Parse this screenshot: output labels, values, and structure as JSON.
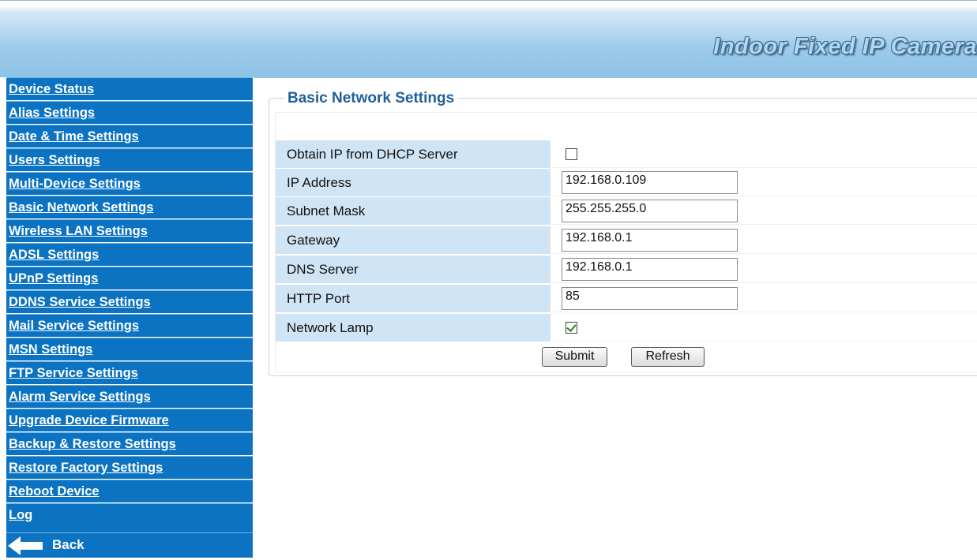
{
  "header": {
    "title": "Indoor Fixed IP Camera"
  },
  "sidebar": {
    "items": [
      {
        "label": "Device Status"
      },
      {
        "label": "Alias Settings"
      },
      {
        "label": "Date & Time Settings"
      },
      {
        "label": "Users Settings"
      },
      {
        "label": "Multi-Device Settings"
      },
      {
        "label": "Basic Network Settings"
      },
      {
        "label": "Wireless LAN Settings"
      },
      {
        "label": "ADSL Settings"
      },
      {
        "label": "UPnP Settings"
      },
      {
        "label": "DDNS Service Settings"
      },
      {
        "label": "Mail Service Settings"
      },
      {
        "label": "MSN Settings"
      },
      {
        "label": "FTP Service Settings"
      },
      {
        "label": "Alarm Service Settings"
      },
      {
        "label": "Upgrade Device Firmware"
      },
      {
        "label": "Backup & Restore Settings"
      },
      {
        "label": "Restore Factory Settings"
      },
      {
        "label": "Reboot Device"
      },
      {
        "label": "Log"
      }
    ],
    "back_label": "Back"
  },
  "section": {
    "title": "Basic Network Settings"
  },
  "form": {
    "dhcp": {
      "label": "Obtain IP from DHCP Server",
      "checked": false
    },
    "ip": {
      "label": "IP Address",
      "value": "192.168.0.109"
    },
    "subnet": {
      "label": "Subnet Mask",
      "value": "255.255.255.0"
    },
    "gateway": {
      "label": "Gateway",
      "value": "192.168.0.1"
    },
    "dns": {
      "label": "DNS Server",
      "value": "192.168.0.1"
    },
    "http_port": {
      "label": "HTTP Port",
      "value": "85"
    },
    "network_lamp": {
      "label": "Network Lamp",
      "checked": true
    }
  },
  "buttons": {
    "submit": "Submit",
    "refresh": "Refresh"
  }
}
